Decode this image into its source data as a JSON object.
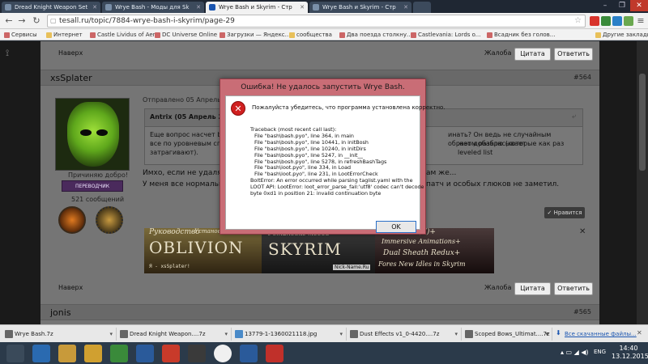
{
  "browser": {
    "tabs": [
      {
        "label": "Dread Knight Weapon Set"
      },
      {
        "label": "Wrye Bash - Моды для Sk"
      },
      {
        "label": "Wrye Bash и Skyrim - Стр"
      },
      {
        "label": "Wrye Bash и Skyrim - Стр"
      }
    ],
    "url": "tesall.ru/topic/7884-wrye-bash-i-skyrim/page-29",
    "bookmarks": [
      {
        "label": "Сервисы"
      },
      {
        "label": "Интернет"
      },
      {
        "label": "Castle Lividus of Aer..."
      },
      {
        "label": "DC Universe Online"
      },
      {
        "label": "Загрузки — Яндекс..."
      },
      {
        "label": "сообщества"
      },
      {
        "label": "Два поезда столкну..."
      },
      {
        "label": "Castlevania: Lords o..."
      },
      {
        "label": "Всадник без голов..."
      },
      {
        "label": "Другие закладки"
      }
    ]
  },
  "page": {
    "top_bar": {
      "back_top": "Наверх",
      "report": "Жалоба",
      "quote": "Цитата",
      "reply": "Ответить"
    },
    "post564": {
      "username": "xsSplater",
      "post_number": "#564",
      "posted_prefix": "Отправлено 05 Апрель 20",
      "reputation": "Причиняю добро!",
      "rank": "ПЕРЕВОДЧИК",
      "posts_count": "521 сообщений",
      "quote_header": "Antrix (05 Апрель 2015",
      "quote_line1": "Еще вопрос насчет bash",
      "quote_line1_end": "инать? Он ведь не случайным образом разбрасывает",
      "quote_line2": "все по уровневым списк",
      "quote_line2_end": "жет добавлю (которые как раз leveled list",
      "quote_line3": "затрагивают).",
      "body_line1": "Имхо, если не удалять",
      "body_line1_end": "ам же...",
      "body_line2": "У меня все нормально",
      "body_line2_end": "патч и особых глюков не заметил.",
      "like_button": "Нравится",
      "signature": {
        "guide": "Руководство",
        "install": "Установке модов",
        "oblivion": "OBLIVION",
        "skyrim": "SKYRIM",
        "install2": "Установке модов",
        "author": "Я - xsSplater!",
        "site": "Nick-Name.Ru",
        "xpms": "XPMS(E)+",
        "anim": "Immersive Animations+",
        "dual": "Dual Sheath Redux+",
        "fores": "Fores New Idles in Skyrim"
      }
    },
    "bottom_bar": {
      "back_top": "Наверх",
      "report": "Жалоба",
      "quote": "Цитата",
      "reply": "Ответить"
    },
    "post565": {
      "username": "jonis",
      "post_number": "#565"
    }
  },
  "dialog": {
    "title": "Ошибка! Не удалось запустить Wrye Bash.",
    "message": "Пожалуйста убедитесь, что программа установлена корректно.",
    "traceback": [
      "Traceback (most recent call last):",
      "File \"bash\\bash.pyo\", line 364, in main",
      "File \"bash\\bosh.pyo\", line 10441, in initBosh",
      "File \"bash\\bosh.pyo\", line 10240, in initDirs",
      "File \"bash\\bosh.pyo\", line 5247, in __init__",
      "File \"bash\\bosh.pyo\", line 5278, in refreshBashTags",
      "File \"bash\\loot.pyo\", line 334, in Load",
      "File \"bash\\loot.pyo\", line 231, in LootErrorCheck",
      "BoltError: An error occurred while parsing taglist.yaml with the",
      "LOOT API: LootError: loot_error_parse_fail:'utf8' codec can't decode",
      "byte 0xd1 in position 21: invalid continuation byte"
    ],
    "ok": "OK"
  },
  "downloads": {
    "items": [
      {
        "label": "Wrye Bash.7z"
      },
      {
        "label": "Dread Knight Weapon....7z"
      },
      {
        "label": "13779-1-1360021118.jpg"
      },
      {
        "label": "Dust Effects v1_0-4420....7z"
      },
      {
        "label": "Scoped Bows_Ultimat....7z"
      }
    ],
    "show_all": "Все скачанные файлы..."
  },
  "taskbar": {
    "lang": "ENG",
    "time": "14:40",
    "date": "13.12.2015"
  }
}
